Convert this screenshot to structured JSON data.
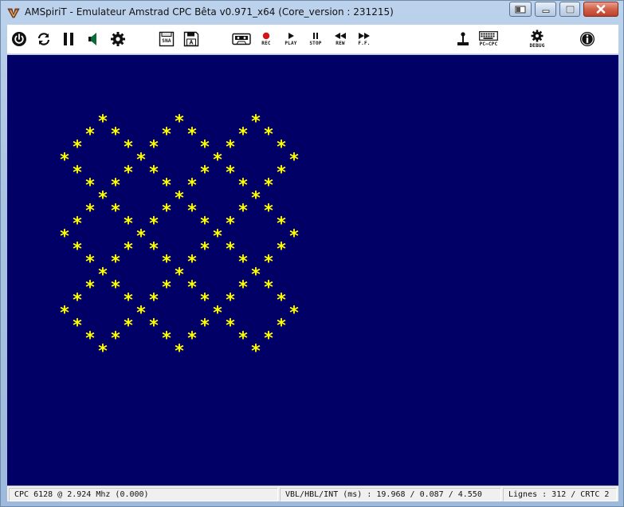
{
  "window": {
    "title": "AMSpiriT - Emulateur Amstrad CPC Bêta v0.971_x64 (Core_version : 231215)"
  },
  "toolbar": {
    "left_icons": [
      "power-icon",
      "reset-icon",
      "pause-icon",
      "sound-icon",
      "settings-icon"
    ],
    "snapshot_label": "SNA",
    "tape": {
      "rec_label": "REC",
      "play_label": "PLAY",
      "stop_label": "STOP",
      "rew_label": "REW",
      "ff_label": "F.F."
    },
    "keyboard_label": "PC⇔CPC",
    "debug_label": "DEBUG"
  },
  "screen": {
    "background": "#000066",
    "glyph": "*",
    "glyph_color": "#ffff00"
  },
  "statusbar": {
    "cpu": "CPC 6128 @ 2.924 Mhz (0.000)",
    "timing": "VBL/HBL/INT (ms) : 19.968 / 0.087 / 4.550",
    "lines": "Lignes : 312 / CRTC 2"
  }
}
